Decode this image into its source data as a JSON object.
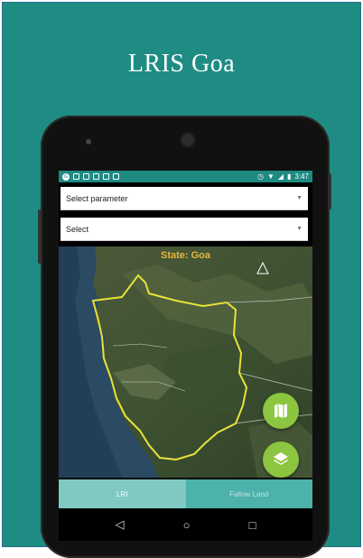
{
  "promo": {
    "title": "LRIS Goa"
  },
  "statusbar": {
    "time": "3:47",
    "badge": "G"
  },
  "dropdowns": [
    {
      "label": "Select parameter"
    },
    {
      "label": "Select"
    }
  ],
  "map": {
    "state_label": "State: Goa"
  },
  "tabs": [
    {
      "label": "LRI"
    },
    {
      "label": "Fallow Land"
    }
  ],
  "icons": {
    "map_fab": "map-icon",
    "layers_fab": "layers-icon",
    "back": "back-icon",
    "home": "home-icon",
    "recents": "recents-icon"
  },
  "colors": {
    "background": "#1f8c83",
    "accent_fab": "#8cc53f",
    "state_label": "#e9b83a",
    "boundary": "#e8e23a"
  }
}
